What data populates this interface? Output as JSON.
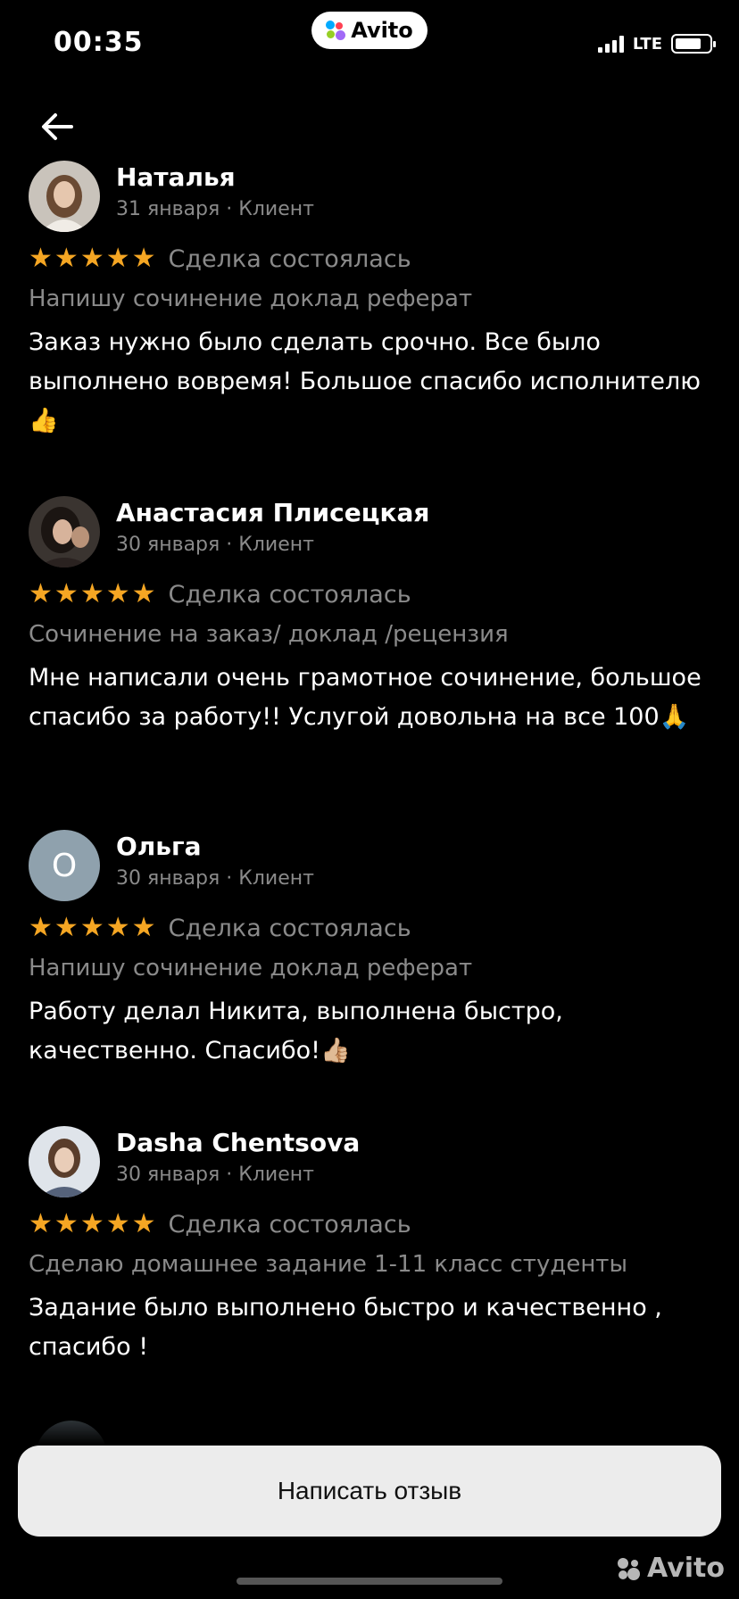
{
  "status_bar": {
    "time": "00:35",
    "network": "LTE"
  },
  "app_badge": {
    "label": "Avito"
  },
  "reviews": [
    {
      "name": "Наталья",
      "meta": "31 января · Клиент",
      "stars": 5,
      "deal": "Сделка состоялась",
      "service": "Напишу сочинение доклад реферат",
      "text": "Заказ нужно было сделать срочно. Все было выполнено вовремя!  Большое спасибо исполнителю👍"
    },
    {
      "name": "Анастасия Плисецкая",
      "meta": "30 января · Клиент",
      "stars": 5,
      "deal": "Сделка состоялась",
      "service": "Сочинение на заказ/ доклад /рецензия",
      "text": "Мне написали очень грамотное сочинение, большое спасибо за работу!! Услугой довольна на все 100🙏"
    },
    {
      "name": "Ольга",
      "avatar_letter": "О",
      "meta": "30 января · Клиент",
      "stars": 5,
      "deal": "Сделка состоялась",
      "service": "Напишу сочинение доклад реферат",
      "text": "Работу делал Никита, выполнена быстро, качественно. Спасибо!👍🏼"
    },
    {
      "name": "Dasha Chentsova",
      "meta": "30 января · Клиент",
      "stars": 5,
      "deal": "Сделка состоялась",
      "service": "Сделаю домашнее задание 1-11 класс студенты",
      "text": "Задание было выполнено быстро и качественно , спасибо !"
    }
  ],
  "write_review_button": {
    "label": "Написать отзыв"
  },
  "watermark": {
    "label": "Avito"
  },
  "colors": {
    "star": "#f5a623",
    "secondary_text": "#8a8a8a",
    "button_bg": "#ececec"
  }
}
